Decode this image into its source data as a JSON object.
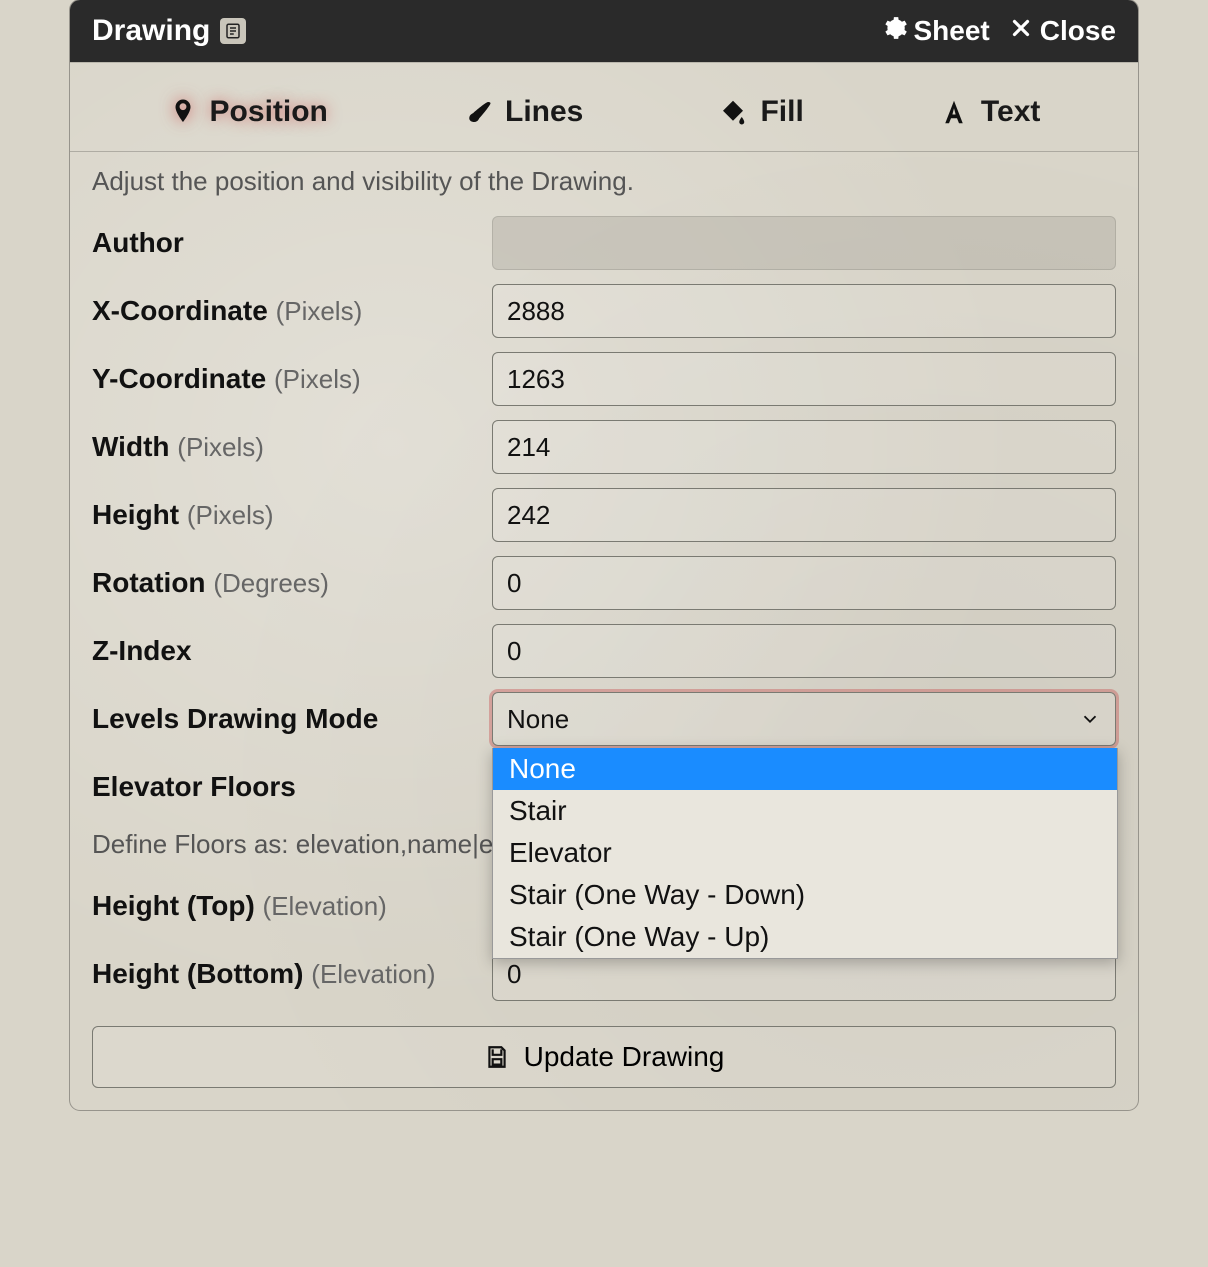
{
  "header": {
    "title": "Drawing",
    "sheet": "Sheet",
    "close": "Close"
  },
  "tabs": {
    "position": "Position",
    "lines": "Lines",
    "fill": "Fill",
    "text": "Text"
  },
  "hint": "Adjust the position and visibility of the Drawing.",
  "labels": {
    "author": "Author",
    "x": "X-Coordinate",
    "y": "Y-Coordinate",
    "width": "Width",
    "height": "Height",
    "rotation": "Rotation",
    "zindex": "Z-Index",
    "levelsMode": "Levels Drawing Mode",
    "elevatorFloors": "Elevator Floors",
    "heightTop": "Height (Top)",
    "heightBottom": "Height (Bottom)"
  },
  "units": {
    "pixels": "(Pixels)",
    "degrees": "(Degrees)",
    "elevation": "(Elevation)"
  },
  "values": {
    "author": "",
    "x": "2888",
    "y": "1263",
    "width": "214",
    "height": "242",
    "rotation": "0",
    "zindex": "0",
    "levelsModeSelected": "None",
    "elevatorFloors": "",
    "heightTop": "",
    "heightBottom": "0"
  },
  "levelsModeOptions": [
    "None",
    "Stair",
    "Elevator",
    "Stair (One Way - Down)",
    "Stair (One Way - Up)"
  ],
  "defineFloorsHint": "Define Floors as: elevation,name|ele",
  "footer": {
    "update": "Update Drawing"
  }
}
